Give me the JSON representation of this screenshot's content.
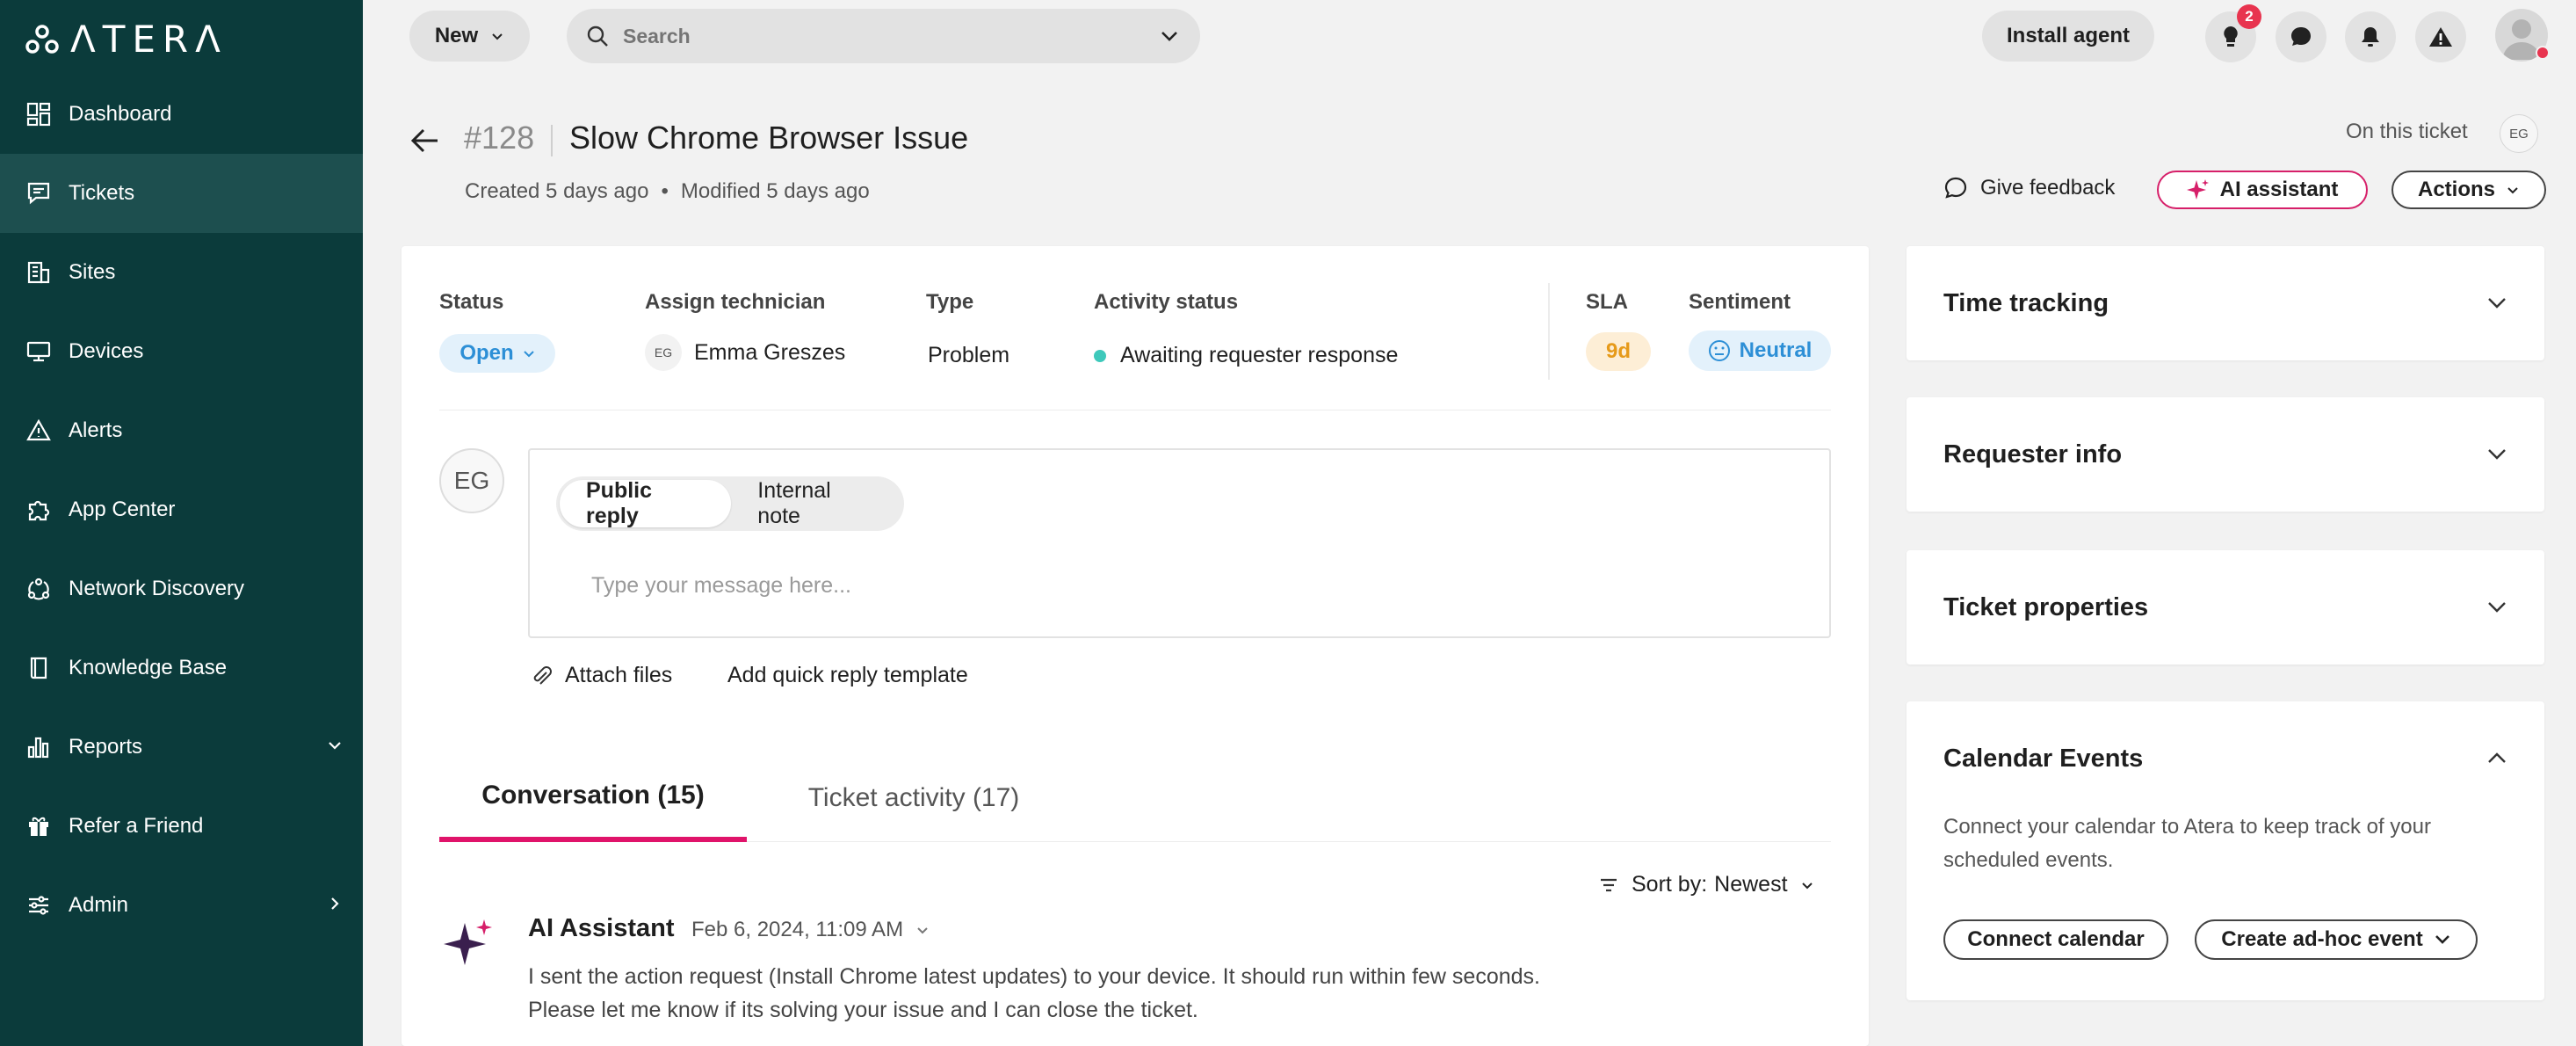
{
  "sidebar": {
    "logo": "ΛTERΛ",
    "items": [
      {
        "label": "Dashboard"
      },
      {
        "label": "Tickets"
      },
      {
        "label": "Sites"
      },
      {
        "label": "Devices"
      },
      {
        "label": "Alerts"
      },
      {
        "label": "App Center"
      },
      {
        "label": "Network Discovery"
      },
      {
        "label": "Knowledge Base"
      },
      {
        "label": "Reports"
      },
      {
        "label": "Refer a Friend"
      },
      {
        "label": "Admin"
      }
    ]
  },
  "topbar": {
    "new_label": "New",
    "search_placeholder": "Search",
    "install_label": "Install agent",
    "notification_count": "2"
  },
  "ticket": {
    "number": "#128",
    "title": "Slow Chrome Browser Issue",
    "created": "Created 5 days ago",
    "meta_sep": "•",
    "modified": "Modified 5 days ago",
    "on_ticket_label": "On this ticket",
    "on_ticket_initials": "EG",
    "give_feedback": "Give feedback",
    "ai_assistant": "AI assistant",
    "actions": "Actions"
  },
  "fields": {
    "status_label": "Status",
    "status_value": "Open",
    "technician_label": "Assign technician",
    "technician_initials": "EG",
    "technician_name": "Emma Greszes",
    "type_label": "Type",
    "type_value": "Problem",
    "activity_label": "Activity status",
    "activity_value": "Awaiting requester response",
    "sla_label": "SLA",
    "sla_value": "9d",
    "sentiment_label": "Sentiment",
    "sentiment_value": "Neutral"
  },
  "reply": {
    "avatar_initials": "EG",
    "tab_public": "Public reply",
    "tab_internal": "Internal note",
    "placeholder": "Type your message here...",
    "attach": "Attach files",
    "quick_template": "Add quick reply template"
  },
  "conversation": {
    "tab_conversation": "Conversation (15)",
    "tab_activity": "Ticket activity (17)",
    "sort_label": "Sort by:",
    "sort_value": "Newest",
    "message": {
      "author": "AI Assistant",
      "date": "Feb 6, 2024, 11:09 AM",
      "line1": "I sent the action request (Install Chrome latest updates) to your device. It should run within few seconds.",
      "line2": "Please let me know if its solving your issue and I can close the ticket."
    }
  },
  "right_panels": {
    "time_tracking": "Time tracking",
    "requester_info": "Requester info",
    "ticket_properties": "Ticket properties",
    "calendar": {
      "title": "Calendar Events",
      "text": "Connect your calendar to Atera to keep track of your scheduled events.",
      "connect": "Connect calendar",
      "adhoc": "Create ad-hoc event"
    }
  },
  "colors": {
    "sidebar_bg": "#0b3b3b",
    "sidebar_active": "#1d4f4f",
    "accent_pink": "#e0136a",
    "status_blue": "#2d8fd6",
    "sla_orange": "#e69a1a",
    "activity_teal": "#3ec9bb",
    "badge_red": "#e8344f"
  },
  "icons": {
    "logo": "atera-logo-icon",
    "dashboard": "dashboard-icon",
    "tickets": "ticket-icon",
    "sites": "building-icon",
    "devices": "monitor-icon",
    "alerts": "warning-icon",
    "app_center": "puzzle-icon",
    "network": "network-icon",
    "knowledge": "book-icon",
    "reports": "bar-chart-icon",
    "refer": "gift-icon",
    "admin": "sliders-icon"
  }
}
